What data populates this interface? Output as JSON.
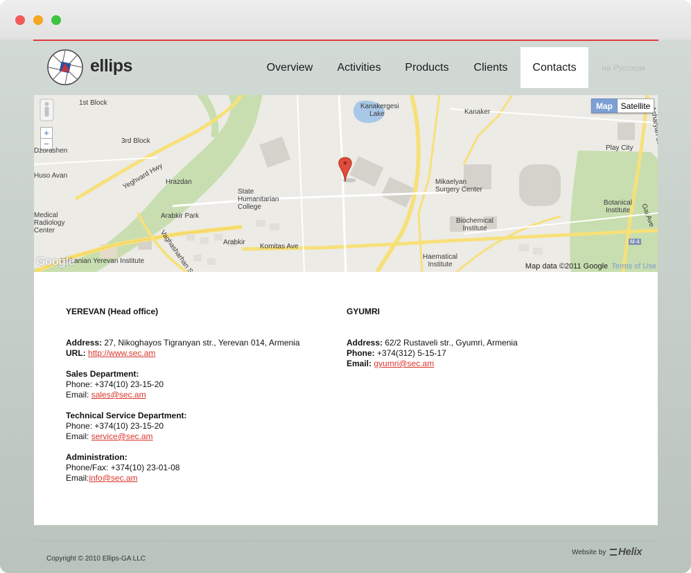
{
  "brand": {
    "name": "ellips"
  },
  "nav": {
    "items": [
      {
        "label": "Overview"
      },
      {
        "label": "Activities"
      },
      {
        "label": "Products"
      },
      {
        "label": "Clients"
      },
      {
        "label": "Contacts"
      }
    ],
    "active": "Contacts",
    "language_link": "на Русском"
  },
  "map": {
    "map_button": "Map",
    "satellite_button": "Satellite",
    "attribution": "Map data ©2011 Google",
    "terms": "Terms of Use",
    "google_logo": "Google",
    "labels": [
      "1st Block",
      "3rd Block",
      "Hrazdan",
      "Arabkir Park",
      "Arabkir",
      "Kanakergesi Lake",
      "Kanaker",
      "Play City",
      "Mikaelyan Surgery Center",
      "Botanical Institute",
      "Biochemical Institute",
      "Haematical Institute",
      "State Humanitarian College",
      "Nikhanian Yerevan Institute",
      "Huso Avan",
      "Dzorashen",
      "Medical Radiology Center",
      "Yeghvard Hwy",
      "Komitas Ave",
      "Acharyan St",
      "Gai Ave",
      "Vaghasharhan St",
      "M-4"
    ],
    "colors": {
      "road": "#f7df5a",
      "park": "#c7dfae",
      "water": "#9fc1e2",
      "block": "#d6d2cc"
    }
  },
  "offices": {
    "yerevan": {
      "title": "YEREVAN (Head office)",
      "address_label": "Address:",
      "address": " 27, Nikoghayos Tigranyan str., Yerevan 014, Armenia",
      "url_label": "URL:",
      "url": "http://www.sec.am",
      "sales_title": "Sales Department:",
      "sales_phone": "Phone: +374(10) 23-15-20",
      "sales_email_label": "Email: ",
      "sales_email": "sales@sec.am",
      "tech_title": "Technical Service Department:",
      "tech_phone": "Phone: +374(10) 23-15-20",
      "tech_email_label": "Email: ",
      "tech_email": "service@sec.am",
      "admin_title": "Administration:",
      "admin_phone": "Phone/Fax: +374(10) 23-01-08",
      "admin_email_label": "Email:",
      "admin_email": "info@sec.am"
    },
    "gyumri": {
      "title": "GYUMRI",
      "address_label": "Address:",
      "address": " 62/2 Rustaveli str., Gyumri, Armenia",
      "phone_label": "Phone:",
      "phone": " +374(312) 5-15-17",
      "email_label": "Email:",
      "email": "gyumri@sec.am"
    }
  },
  "footer": {
    "copyright": "Copyright © 2010 Ellips-GA LLC",
    "website_by": "Website by",
    "helix": "Helix"
  },
  "colors": {
    "accent": "#e03a3e",
    "link": "#d9352c",
    "map_button_active": "#7c9fd4"
  }
}
